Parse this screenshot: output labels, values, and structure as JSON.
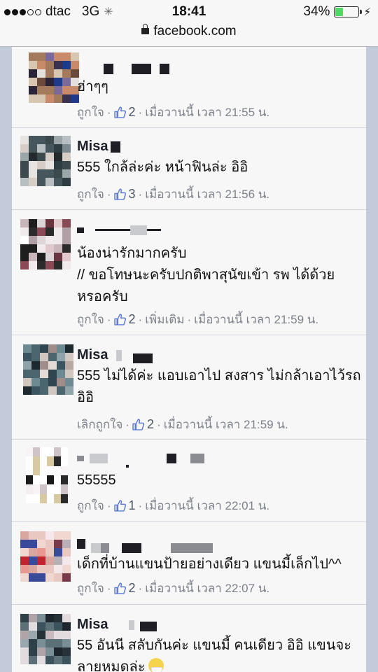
{
  "status_bar": {
    "carrier": "dtac",
    "network": "3G",
    "time": "18:41",
    "battery_percent": "34%",
    "battery_level": 0.34
  },
  "url_bar": {
    "domain": "facebook.com"
  },
  "colors": {
    "like_blue": "#5b7bd5",
    "meta_gray": "#7d818a",
    "battery_green": "#4cd964"
  },
  "comments": [
    {
      "name": "",
      "text": "ฮ่าๆๆ",
      "like_label": "ถูกใจ",
      "likes": "2",
      "more": "",
      "time": "เมื่อวานนี้ เวลา 21:55 น."
    },
    {
      "name": "Misa",
      "text": "555 ใกล้ล่ะค่ะ หน้าฟินล่ะ อิอิ",
      "like_label": "ถูกใจ",
      "likes": "3",
      "more": "",
      "time": "เมื่อวานนี้ เวลา 21:56 น."
    },
    {
      "name": "",
      "text": "น้องน่ารักมากครับ\n// ขอโทษนะครับปกติพาสุนัขเข้า รพ ได้ด้วย\nหรอครับ",
      "like_label": "ถูกใจ",
      "likes": "2",
      "more": "เพิ่มเติม",
      "time": "เมื่อวานนี้ เวลา 21:59 น."
    },
    {
      "name": "Misa",
      "text": "555 ไม่ได้ค่ะ แอบเอาไป สงสาร ไม่กล้าเอาไว้รถ\nอิอิ",
      "like_label": "เลิกถูกใจ",
      "likes": "2",
      "more": "",
      "time": "เมื่อวานนี้ เวลา 21:59 น."
    },
    {
      "name": "",
      "text": "55555",
      "like_label": "ถูกใจ",
      "likes": "1",
      "more": "",
      "time": "เมื่อวานนี้ เวลา 22:01 น."
    },
    {
      "name": "",
      "text": "เด็กที่บ้านแขนป้ายอย่างเดียว แขนมี้เล็กไป^^",
      "like_label": "ถูกใจ",
      "likes": "2",
      "more": "",
      "time": "เมื่อวานนี้ เวลา 22:07 น."
    },
    {
      "name": "Misa",
      "text": "55 อันนี สลับกันค่ะ แขนมี้ คนเดียว อิอิ แขนจะ\nลายหมดล่ะ",
      "like_label": "",
      "likes": "",
      "more": "",
      "time": ""
    }
  ]
}
